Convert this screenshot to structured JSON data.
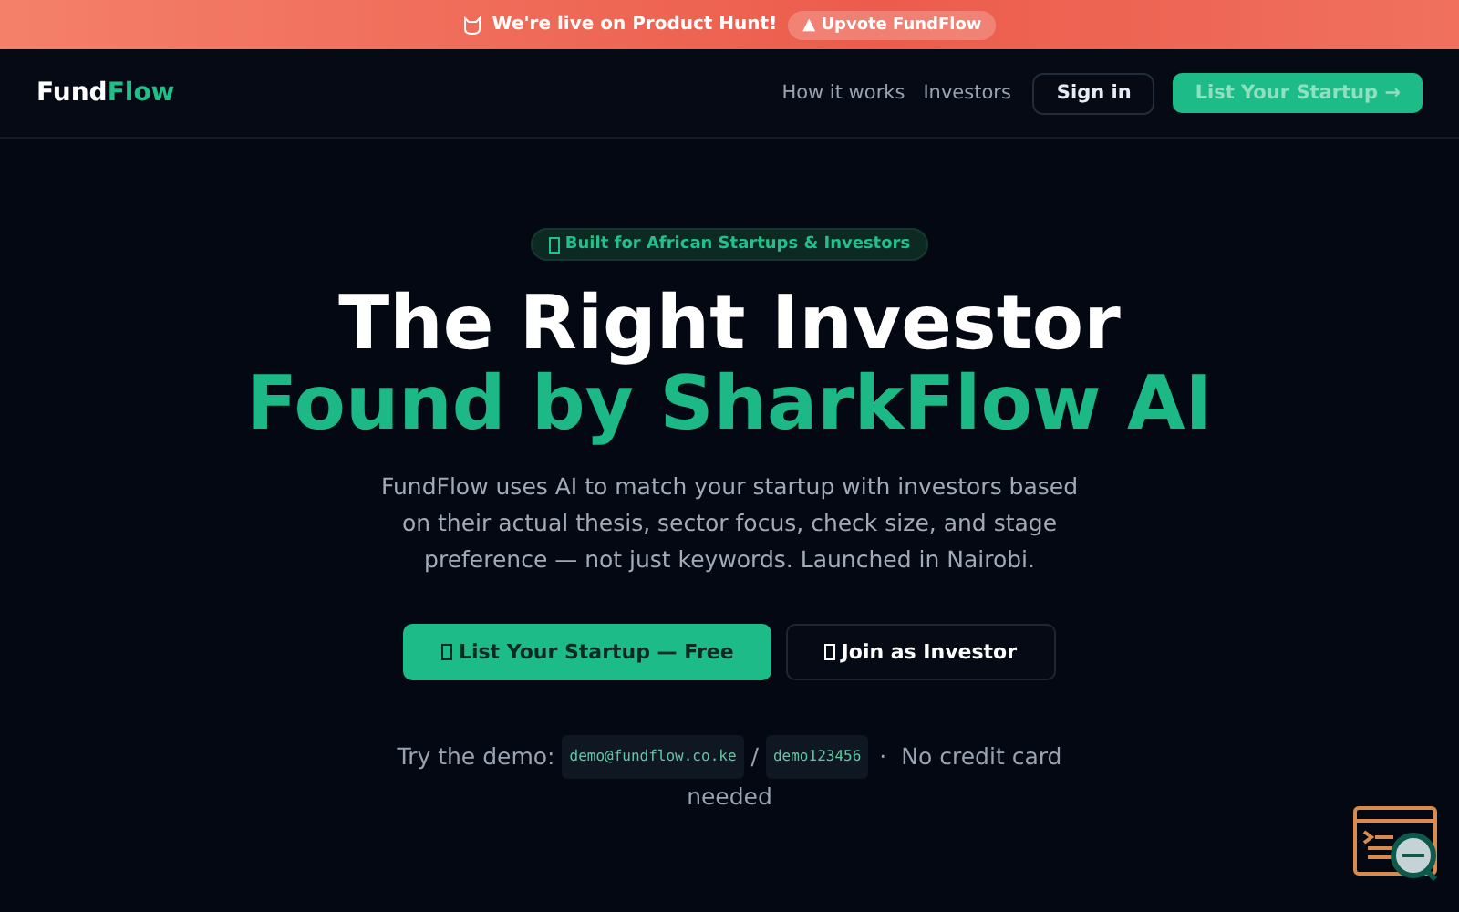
{
  "banner": {
    "text": "We're live on Product Hunt!",
    "button": "▲ Upvote FundFlow"
  },
  "nav": {
    "logo": {
      "part_1": "Fund",
      "part_2": "Flow"
    },
    "links": [
      "How it works",
      "Investors"
    ],
    "sign_in": "Sign in",
    "cta": "List Your Startup →"
  },
  "hero": {
    "badge": "Built for African Startups & Investors",
    "title_line_1": "The Right Investor",
    "title_line_2": "Found by SharkFlow AI",
    "description": "FundFlow uses AI to match your startup with investors based on their actual thesis, sector focus, check size, and stage preference — not just keywords. Launched in Nairobi.",
    "buttons": [
      {
        "label": "List Your Startup — Free",
        "kind": "primary"
      },
      {
        "label": "Join as Investor",
        "kind": "secondary"
      }
    ],
    "demo": {
      "prefix": "Try the demo:",
      "email": "demo@fundflow.co.ke",
      "separator": "/",
      "password": "demo123456",
      "dot": "·",
      "note": "No credit card",
      "note_end": "needed"
    }
  }
}
